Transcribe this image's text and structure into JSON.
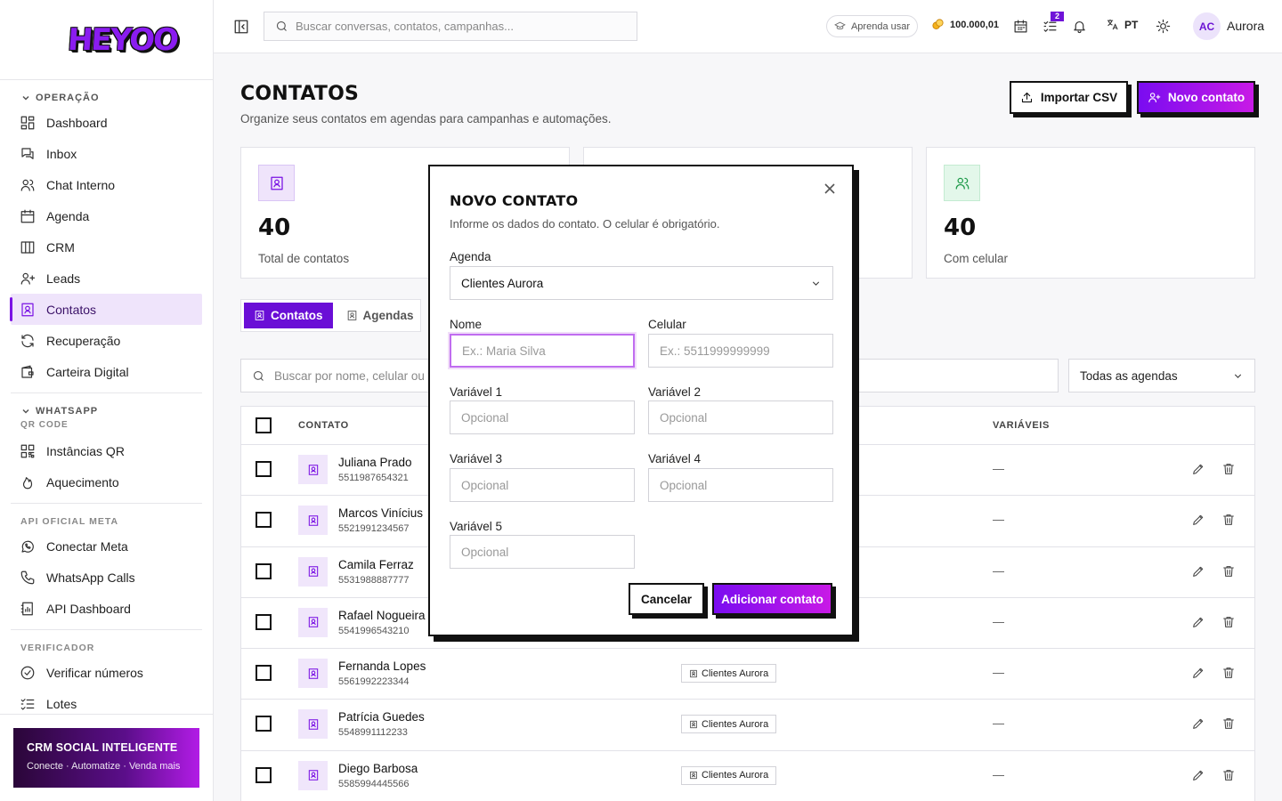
{
  "brand": {
    "logo_text": "HEYOO"
  },
  "sidebar": {
    "sections": [
      {
        "title": "OPERAÇÃO",
        "items": [
          "Dashboard",
          "Inbox",
          "Chat Interno",
          "Agenda",
          "CRM",
          "Leads",
          "Contatos",
          "Recuperação",
          "Carteira Digital"
        ]
      },
      {
        "title": "WHATSAPP",
        "subtitle": "QR CODE",
        "items": [
          "Instâncias QR",
          "Aquecimento"
        ]
      },
      {
        "title": "API OFICIAL META",
        "items": [
          "Conectar Meta",
          "WhatsApp Calls",
          "API Dashboard"
        ]
      },
      {
        "title": "VERIFICADOR",
        "items": [
          "Verificar números",
          "Lotes"
        ]
      }
    ],
    "active_item": "Contatos",
    "promo": {
      "title": "CRM SOCIAL INTELIGENTE",
      "subtitle": "Conecte · Automatize · Venda mais"
    }
  },
  "topbar": {
    "search_placeholder": "Buscar conversas, contatos, campanhas...",
    "learn_label": "Aprenda usar",
    "credits": "100.000,01",
    "tasks_badge": "2",
    "language": "PT",
    "user_initials": "AC",
    "user_name": "Aurora"
  },
  "page": {
    "title": "CONTATOS",
    "subtitle": "Organize seus contatos em agendas para campanhas e automações.",
    "import_label": "Importar CSV",
    "new_label": "Novo contato"
  },
  "stats": [
    {
      "value": "40",
      "label": "Total de contatos"
    },
    {
      "value": "40",
      "label": "Com celular"
    }
  ],
  "tabs": [
    {
      "label": "Contatos",
      "active": true
    },
    {
      "label": "Agendas",
      "active": false
    }
  ],
  "list": {
    "search_placeholder": "Buscar por nome, celular ou va",
    "agenda_filter": "Todas as agendas",
    "columns": {
      "contact": "CONTATO",
      "variables": "VARIÁVEIS"
    },
    "rows": [
      {
        "name": "Juliana Prado",
        "phone": "5511987654321",
        "agenda": "",
        "vars": "—"
      },
      {
        "name": "Marcos Vinícius",
        "phone": "5521991234567",
        "agenda": "",
        "vars": "—"
      },
      {
        "name": "Camila Ferraz",
        "phone": "5531988887777",
        "agenda": "",
        "vars": "—"
      },
      {
        "name": "Rafael Nogueira",
        "phone": "5541996543210",
        "agenda": "",
        "vars": "—"
      },
      {
        "name": "Fernanda Lopes",
        "phone": "5561992223344",
        "agenda": "Clientes Aurora",
        "vars": "—"
      },
      {
        "name": "Patrícia Guedes",
        "phone": "5548991112233",
        "agenda": "Clientes Aurora",
        "vars": "—"
      },
      {
        "name": "Diego Barbosa",
        "phone": "5585994445566",
        "agenda": "Clientes Aurora",
        "vars": "—"
      }
    ]
  },
  "modal": {
    "title": "NOVO CONTATO",
    "subtitle": "Informe os dados do contato. O celular é obrigatório.",
    "agenda_label": "Agenda",
    "agenda_value": "Clientes Aurora",
    "name_label": "Nome",
    "name_placeholder": "Ex.: Maria Silva",
    "phone_label": "Celular",
    "phone_placeholder": "Ex.: 5511999999999",
    "var_labels": [
      "Variável 1",
      "Variável 2",
      "Variável 3",
      "Variável 4",
      "Variável 5"
    ],
    "var_placeholder": "Opcional",
    "cancel_label": "Cancelar",
    "submit_label": "Adicionar contato"
  },
  "colors": {
    "accent": "#7a12e4",
    "accent_light": "#efe4fb",
    "green_bg": "#e3f7ea",
    "green": "#1f9a4a"
  }
}
